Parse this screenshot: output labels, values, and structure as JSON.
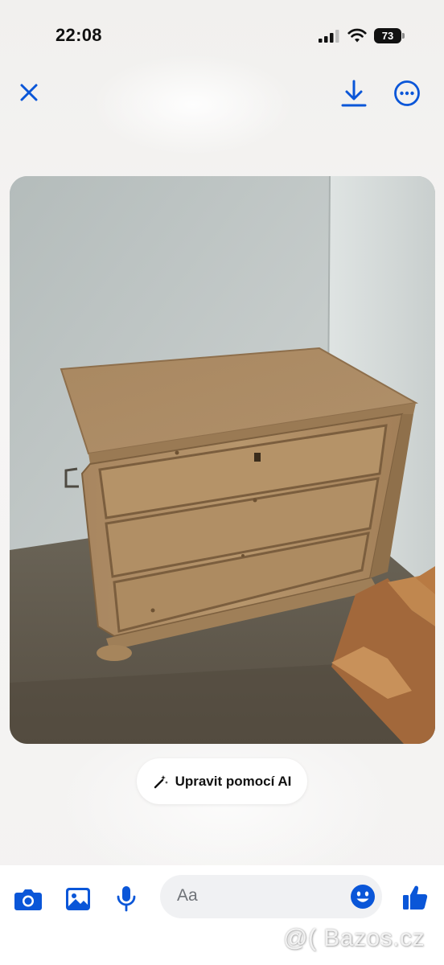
{
  "status_bar": {
    "time": "22:08",
    "battery_level": "73",
    "signal_icon": "cellular-signal-icon",
    "wifi_icon": "wifi-icon"
  },
  "top_bar": {
    "close_icon": "close-icon",
    "download_icon": "download-icon",
    "more_icon": "more-options-icon"
  },
  "photo": {
    "subject": "wooden chest of drawers"
  },
  "ai_edit": {
    "label": "Upravit pomocí AI",
    "icon": "magic-wand-icon"
  },
  "composer": {
    "placeholder": "Aa",
    "icons": [
      "camera-icon",
      "gallery-icon",
      "microphone-icon",
      "emoji-icon",
      "thumbs-up-icon"
    ]
  },
  "watermark": "@( Bazos.cz",
  "colors": {
    "accent": "#0a56d8",
    "background": "#f4f3f2",
    "pill": "#ffffff",
    "input": "#f0f1f3"
  }
}
